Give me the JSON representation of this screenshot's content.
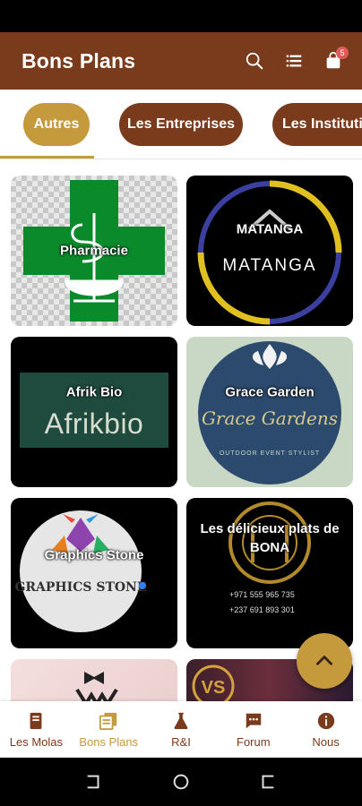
{
  "header": {
    "title": "Bons Plans",
    "cart_badge": "5"
  },
  "icons": {
    "search": "search-icon",
    "list": "list-icon",
    "cart": "shopping-bag-icon"
  },
  "tabs": [
    {
      "label": "Autres",
      "active": true
    },
    {
      "label": "Les Entreprises",
      "active": false
    },
    {
      "label": "Les Institutions",
      "active": false
    }
  ],
  "cards": [
    {
      "label": "Pharmacie"
    },
    {
      "label": "MATANGA",
      "logo_text": "MATANGA"
    },
    {
      "label": "Afrik Bio",
      "logo_text": "Afrikbio"
    },
    {
      "label": "Grace Garden",
      "logo_text": "Grace Gardens",
      "logo_sub": "OUTDOOR EVENT STYLIST"
    },
    {
      "label": "Graphics Stone",
      "logo_text": "GRAPHICS STONE"
    },
    {
      "label": "Les délicieux plats de BONA",
      "details": [
        "+971 555 965 735",
        "+237 691 893 301"
      ]
    },
    {
      "label": ""
    },
    {
      "label": ""
    }
  ],
  "bottom_nav": [
    {
      "label": "Les Molas",
      "icon": "book-icon",
      "active": false
    },
    {
      "label": "Bons Plans",
      "icon": "deals-icon",
      "active": true
    },
    {
      "label": "R&I",
      "icon": "flask-icon",
      "active": false
    },
    {
      "label": "Forum",
      "icon": "chat-icon",
      "active": false
    },
    {
      "label": "Nous",
      "icon": "info-icon",
      "active": false
    }
  ],
  "colors": {
    "brand": "#7a3a1c",
    "accent": "#c49a3c"
  }
}
